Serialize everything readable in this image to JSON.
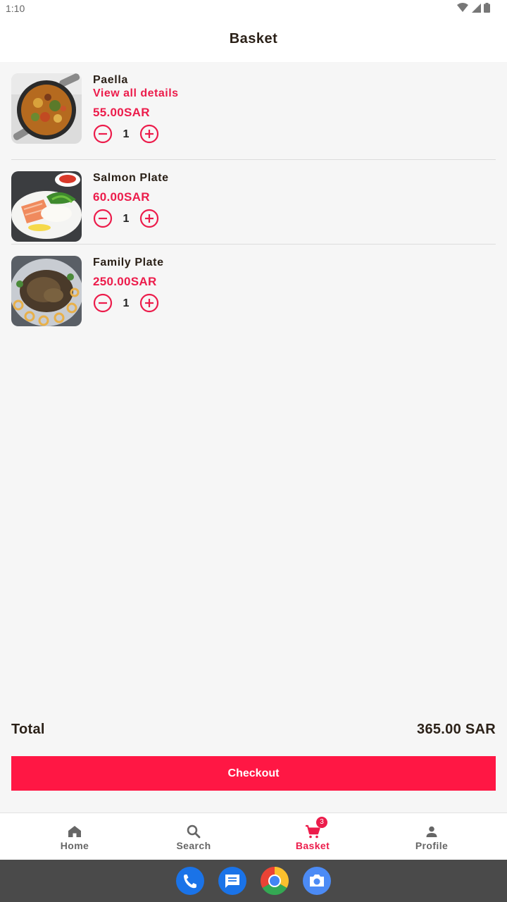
{
  "status_bar": {
    "time": "1:10"
  },
  "header": {
    "title": "Basket"
  },
  "basket": {
    "items": [
      {
        "name": "Paella",
        "details_link": "View all details",
        "price": "55.00SAR",
        "quantity": "1"
      },
      {
        "name": "Salmon Plate",
        "price": "60.00SAR",
        "quantity": "1"
      },
      {
        "name": "Family Plate",
        "price": "250.00SAR",
        "quantity": "1"
      }
    ]
  },
  "summary": {
    "total_label": "Total",
    "total_value": "365.00 SAR"
  },
  "checkout": {
    "label": "Checkout"
  },
  "bottom_nav": {
    "items": [
      {
        "label": "Home",
        "icon": "home-icon"
      },
      {
        "label": "Search",
        "icon": "search-icon"
      },
      {
        "label": "Basket",
        "icon": "cart-icon",
        "badge": "3",
        "active": true
      },
      {
        "label": "Profile",
        "icon": "person-icon"
      }
    ]
  },
  "dock": {
    "apps": [
      "phone-app-icon",
      "messages-app-icon",
      "chrome-app-icon",
      "camera-app-icon"
    ]
  },
  "colors": {
    "accent": "#ec1c4b",
    "checkout": "#ff1744",
    "text_dark": "#2b2118",
    "nav_inactive": "#666666",
    "background": "#f6f6f6"
  }
}
